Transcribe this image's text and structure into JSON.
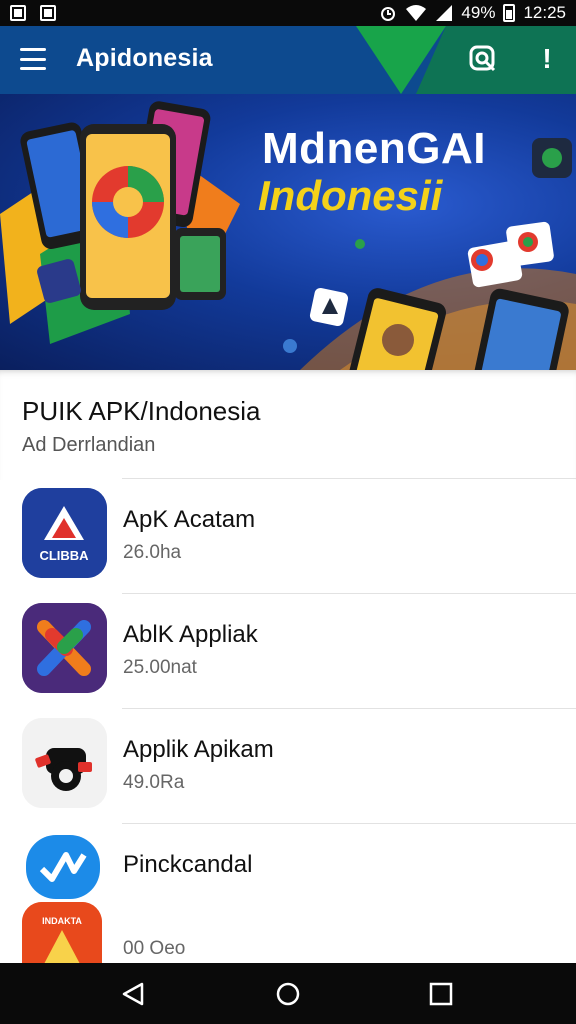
{
  "status_bar": {
    "battery": "49%",
    "time": "12:25"
  },
  "app_bar": {
    "title": "Apidonesia"
  },
  "banner": {
    "title": "MdnenGAI",
    "subtitle": "Indonesii"
  },
  "section": {
    "title": "PUIK APK/Indonesia",
    "subtitle": "Ad Derrlandian"
  },
  "apps": [
    {
      "name": "ApK Acatam",
      "size": "26.0ha",
      "icon_text": "CLIBBA"
    },
    {
      "name": "AblK Appliak",
      "size": "25.00nat"
    },
    {
      "name": "Applik Apikam",
      "size": "49.0Ra"
    },
    {
      "name": "Pinckcandal",
      "size": ""
    },
    {
      "name": "",
      "size": "00 Oeo",
      "icon_text": "INDAKTA"
    }
  ],
  "colors": {
    "app_bar": "#0d4a8f",
    "accent_green": "#18a44a",
    "banner_yellow": "#f4d21a"
  }
}
